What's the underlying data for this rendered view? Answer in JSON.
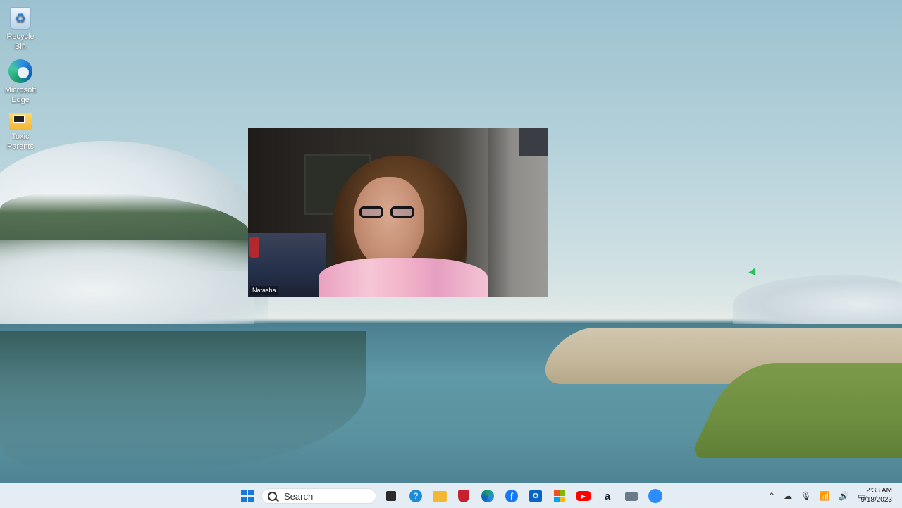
{
  "desktop": {
    "icons": [
      {
        "label": "Recycle Bin",
        "icon": "recycle-bin-icon"
      },
      {
        "label": "Microsoft Edge",
        "icon": "edge-icon"
      },
      {
        "label": "Toxic Parents",
        "icon": "folder-icon"
      }
    ]
  },
  "video": {
    "participant_name": "Natasha"
  },
  "taskbar": {
    "search_placeholder": "Search",
    "pinned": [
      {
        "name": "task-view",
        "icon": "task-view-icon",
        "color": "#2b2b2b"
      },
      {
        "name": "help",
        "icon": "help-icon",
        "color": "#1f8ad6"
      },
      {
        "name": "file-explorer",
        "icon": "folder-icon",
        "color": "#f2b736"
      },
      {
        "name": "mcafee",
        "icon": "mcafee-icon",
        "color": "#c8202f"
      },
      {
        "name": "edge",
        "icon": "edge-icon",
        "color": "#1c9e9e"
      },
      {
        "name": "facebook",
        "icon": "facebook-icon",
        "color": "#1877f2"
      },
      {
        "name": "outlook",
        "icon": "outlook-icon",
        "color": "#0a64c4"
      },
      {
        "name": "store",
        "icon": "store-icon",
        "color": "#f0b429"
      },
      {
        "name": "youtube",
        "icon": "youtube-icon",
        "color": "#ff0000"
      },
      {
        "name": "amazon",
        "icon": "amazon-icon",
        "color": "#ffffff"
      },
      {
        "name": "camera",
        "icon": "camera-icon",
        "color": "#6b7a8a"
      },
      {
        "name": "zoom",
        "icon": "zoom-icon",
        "color": "#2d8cff"
      }
    ],
    "clock_time": "2:33 AM",
    "clock_date": "9/18/2023"
  }
}
